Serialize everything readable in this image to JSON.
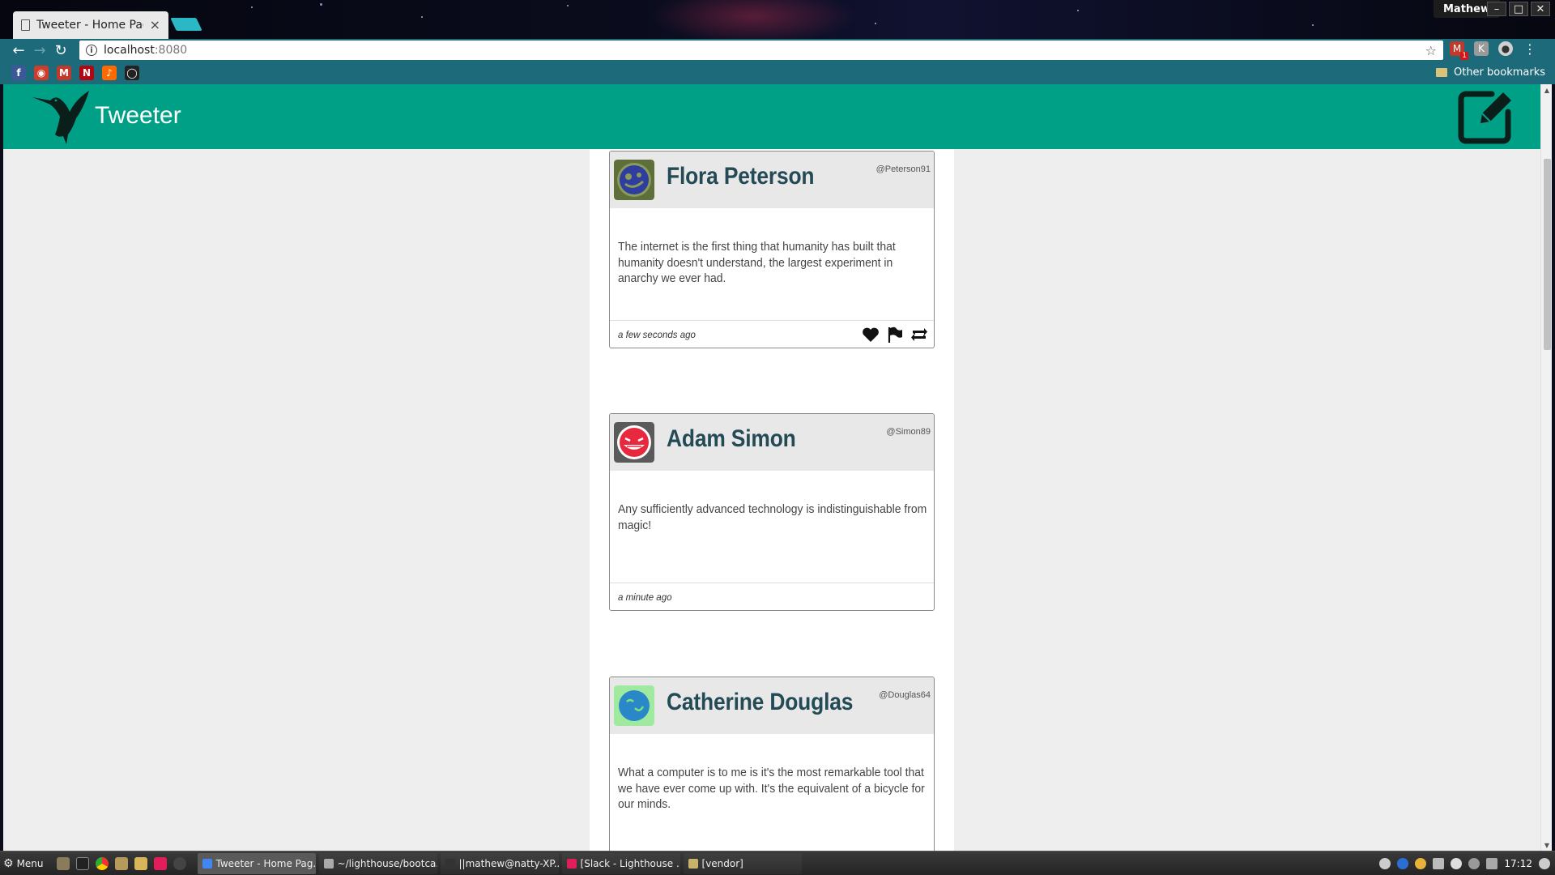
{
  "browser": {
    "tab_title": "Tweeter - Home Page",
    "tab_close": "×",
    "profile_name": "Mathew",
    "window_buttons": [
      "–",
      "□",
      "✕"
    ],
    "url_host": "localhost",
    "url_port": ":8080",
    "other_bookmarks": "Other bookmarks",
    "extension_badge": "1"
  },
  "bookmarks": [
    {
      "icon": "facebook-icon",
      "glyph": "f",
      "color": "#3b5998"
    },
    {
      "icon": "reddit-icon",
      "glyph": "◉",
      "color": "#cc3d2b"
    },
    {
      "icon": "gmail-icon",
      "glyph": "M",
      "color": "#c0392b"
    },
    {
      "icon": "netflix-icon",
      "glyph": "N",
      "color": "#b20710"
    },
    {
      "icon": "soundcloud-icon",
      "glyph": "♪",
      "color": "#ff6a00"
    },
    {
      "icon": "github-icon",
      "glyph": "◯",
      "color": "#222222"
    }
  ],
  "app": {
    "title": "Tweeter",
    "accent": "#00a087"
  },
  "tweets": [
    {
      "name": "Flora Peterson",
      "handle": "@Peterson91",
      "text": "The internet is the first thing that humanity has built that humanity doesn't understand, the largest experiment in anarchy we ever had.",
      "time": "a few seconds ago",
      "avatar_bg": "#8a9b5c",
      "avatar_fg": "#2f3d9e",
      "show_actions": true
    },
    {
      "name": "Adam Simon",
      "handle": "@Simon89",
      "text": "Any sufficiently advanced technology is indistinguishable from magic!",
      "time": "a minute ago",
      "avatar_bg": "#ff3b5a",
      "avatar_fg": "#d02040",
      "show_actions": false
    },
    {
      "name": "Catherine Douglas",
      "handle": "@Douglas64",
      "text": "What a computer is to me is it's the most remarkable tool that we have ever come up with.   It's the equivalent of a bicycle for our minds.",
      "time": "",
      "avatar_bg": "#7fe07f",
      "avatar_fg": "#2a88c8",
      "show_actions": false
    }
  ],
  "taskbar": {
    "menu_label": "Menu",
    "tasks": [
      {
        "label": "Tweeter - Home Pag...",
        "color": "#4285f4",
        "active": true
      },
      {
        "label": "~/lighthouse/bootca...",
        "color": "#aaa",
        "active": false
      },
      {
        "label": "||mathew@natty-XP...",
        "color": "#333",
        "active": false
      },
      {
        "label": "[Slack - Lighthouse ...",
        "color": "#e01e5a",
        "active": false
      },
      {
        "label": "[vendor]",
        "color": "#c9b26c",
        "active": false
      }
    ],
    "clock": "17:12"
  }
}
